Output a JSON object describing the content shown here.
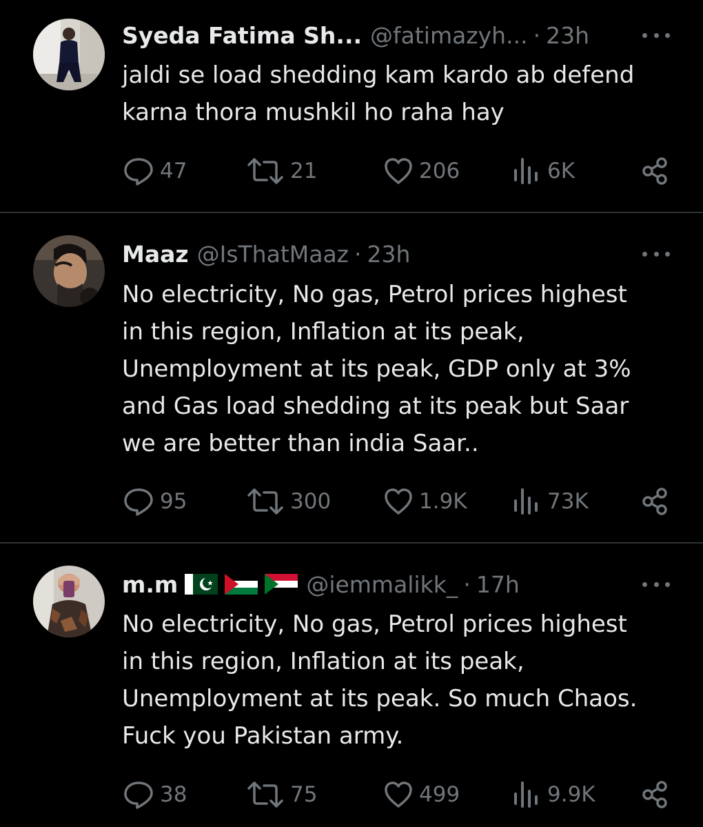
{
  "tweets": [
    {
      "name": "Syeda Fatima Sh...",
      "handle": "@fatimazyh...",
      "separator": "·",
      "time": "23h",
      "lines": [
        "jaldi se load shedding kam kardo ab defend",
        "karna thora mushkil ho raha hay"
      ],
      "replies": "47",
      "reposts": "21",
      "likes": "206",
      "views": "6K",
      "avatar_icon": "woman-in-dark-outfit-photo"
    },
    {
      "name": "Maaz",
      "handle": "@IsThatMaaz",
      "separator": "·",
      "time": "23h",
      "lines": [
        "No electricity, No gas, Petrol prices highest",
        "in this region, Inflation at its peak,",
        "Unemployment at its peak, GDP only at 3%",
        "and Gas load shedding at its peak but Saar",
        "we are better than india Saar.."
      ],
      "replies": "95",
      "reposts": "300",
      "likes": "1.9K",
      "views": "73K",
      "avatar_icon": "man-portrait-photo"
    },
    {
      "name": "m.m",
      "flags": [
        "pakistan-flag",
        "palestine-flag",
        "sudan-flag"
      ],
      "handle": "@iemmalikk_",
      "separator": "·",
      "time": "17h",
      "lines": [
        "No electricity, No gas, Petrol prices highest",
        "in this region, Inflation at its peak,",
        "Unemployment at its peak. So much Chaos.",
        "Fuck you Pakistan army."
      ],
      "replies": "38",
      "reposts": "75",
      "likes": "499",
      "views": "9.9K",
      "avatar_icon": "mirror-selfie-photo"
    }
  ],
  "colors": {
    "background": "#000000",
    "primary_text": "#e7e9ea",
    "secondary_text": "#71767b",
    "divider": "#2f3336"
  }
}
